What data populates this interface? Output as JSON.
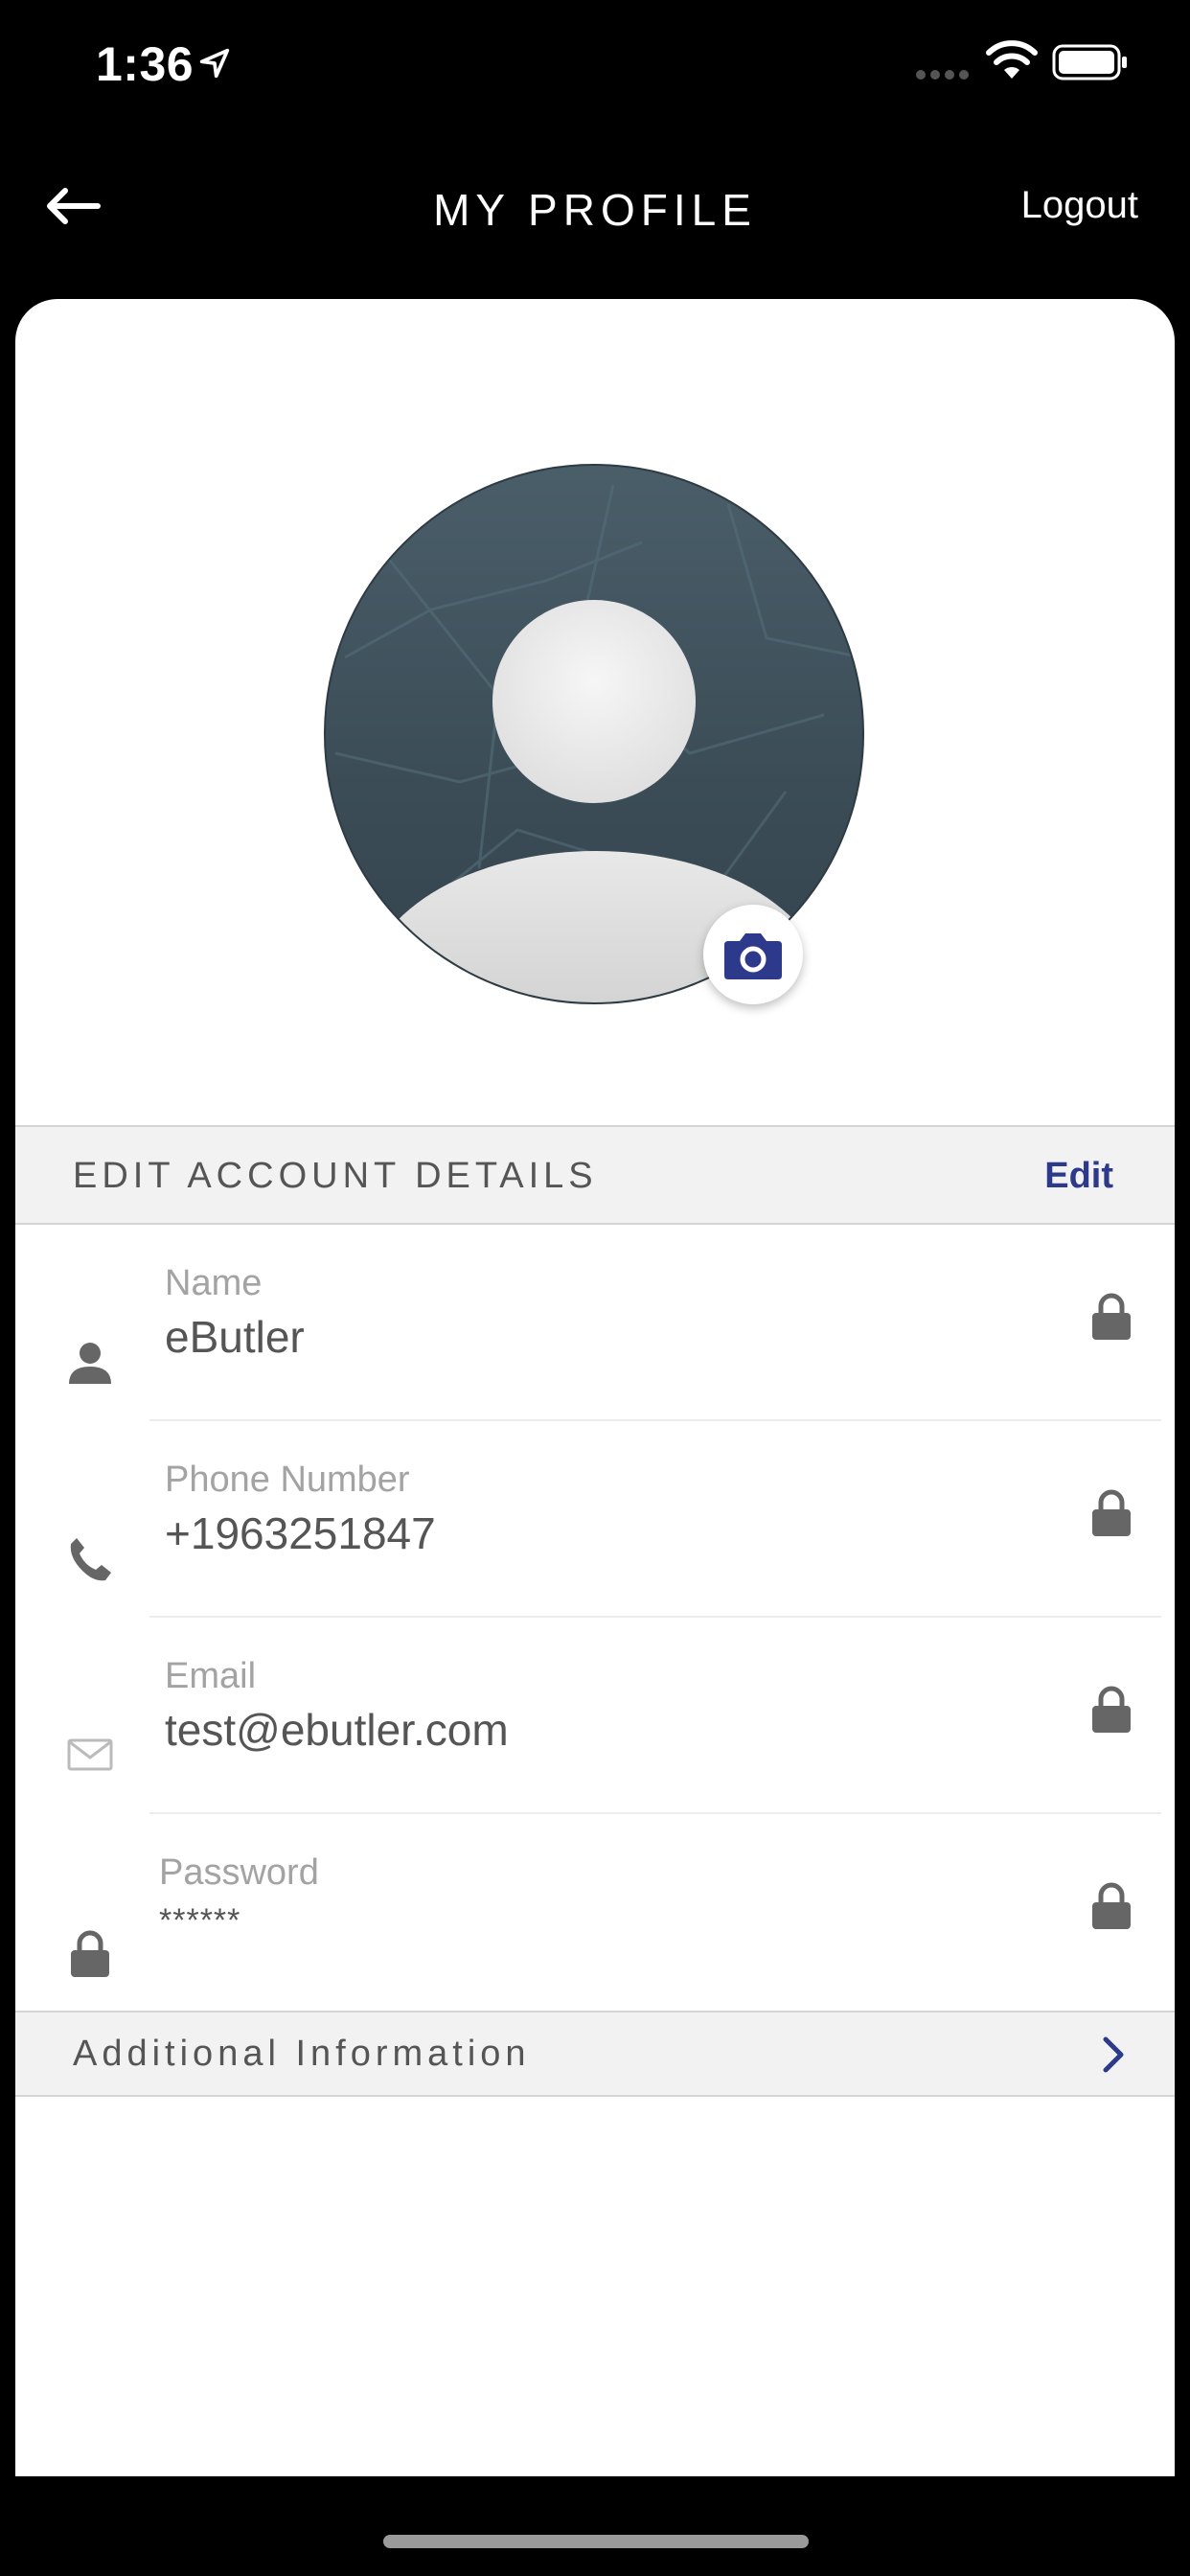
{
  "status_bar": {
    "time": "1:36"
  },
  "header": {
    "title": "MY PROFILE",
    "logout_label": "Logout"
  },
  "account_section": {
    "title": "EDIT ACCOUNT DETAILS",
    "edit_label": "Edit"
  },
  "fields": [
    {
      "label": "Name",
      "value": "eButler",
      "icon": "person-icon"
    },
    {
      "label": "Phone Number",
      "value": "+1963251847",
      "icon": "phone-icon"
    },
    {
      "label": "Email",
      "value": "test@ebutler.com",
      "icon": "mail-icon"
    },
    {
      "label": "Password",
      "value": "******",
      "icon": "lock-icon"
    }
  ],
  "additional": {
    "title": "Additional Information"
  },
  "colors": {
    "accent": "#2d3a8c",
    "header_bg": "#000000",
    "section_bg": "#f2f2f2"
  }
}
